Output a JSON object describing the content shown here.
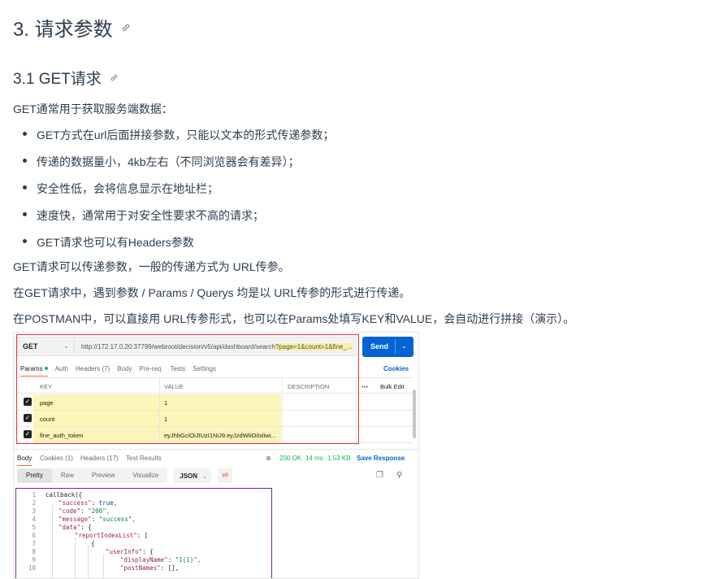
{
  "heading": {
    "title": "3. 请求参数",
    "icon": "link-icon"
  },
  "subheading": {
    "title": "3.1 GET请求",
    "icon": "link-icon"
  },
  "intro": "GET通常用于获取服务端数据：",
  "bullets": [
    "GET方式在url后面拼接参数，只能以文本的形式传递参数；",
    "传递的数据量小，4kb左右（不同浏览器会有差异）；",
    "安全性低，会将信息显示在地址栏；",
    "速度快，通常用于对安全性要求不高的请求；",
    "GET请求也可以有Headers参数"
  ],
  "paragraphs": [
    "GET请求可以传递参数，一般的传递方式为 URL传参。",
    "在GET请求中，遇到参数 / Params / Querys 均是以 URL传参的形式进行传递。",
    "在POSTMAN中，可以直接用 URL传参形式，也可以在Params处填写KEY和VALUE，会自动进行拼接（演示）。"
  ],
  "postman": {
    "method": "GET",
    "url_base": "http://172.17.0.20:37799/webroot/decision/v5/api/dashboard/search",
    "url_query": "?page=1&count=1&fine_...",
    "send": "Send",
    "tabs": {
      "params": "Params",
      "auth": "Auth",
      "headers": "Headers (7)",
      "body": "Body",
      "prereq": "Pre-req.",
      "tests": "Tests",
      "settings": "Settings"
    },
    "cookies": "Cookies",
    "columns": {
      "key": "KEY",
      "value": "VALUE",
      "description": "DESCRIPTION",
      "more": "•••",
      "bulk": "Bulk Edit"
    },
    "params": [
      {
        "key": "page",
        "value": "1"
      },
      {
        "key": "count",
        "value": "1"
      },
      {
        "key": "fine_auth_token",
        "value": "eyJhbGciOiJIUzI1NiJ9.eyJzdWIiOiIxliwi..."
      }
    ],
    "response": {
      "tabs": {
        "body": "Body",
        "cookies": "Cookies (1)",
        "headers": "Headers (17)",
        "results": "Test Results"
      },
      "status": "200 OK",
      "time": "14 ms",
      "size": "1.53 KB",
      "save": "Save Response"
    },
    "view": {
      "pretty": "Pretty",
      "raw": "Raw",
      "preview": "Preview",
      "visualize": "Visualize",
      "format": "JSON"
    },
    "code_lines": [
      "1",
      "2",
      "3",
      "4",
      "5",
      "6",
      "7",
      "8",
      "9",
      "10"
    ],
    "code": {
      "l1": "callback({",
      "l2k": "\"success\"",
      "l2v": "true,",
      "l3k": "\"code\"",
      "l3v": "\"200\",",
      "l4k": "\"message\"",
      "l4v": "\"success\",",
      "l5k": "\"data\"",
      "l5v": "{",
      "l6k": "\"reportIndexList\"",
      "l6v": "[",
      "l7": "{",
      "l8k": "\"userInfo\"",
      "l8v": "{",
      "l9k": "\"displayName\"",
      "l9v": "\"1(1)\",",
      "l10k": "\"postNames\"",
      "l10v": "[],"
    }
  }
}
